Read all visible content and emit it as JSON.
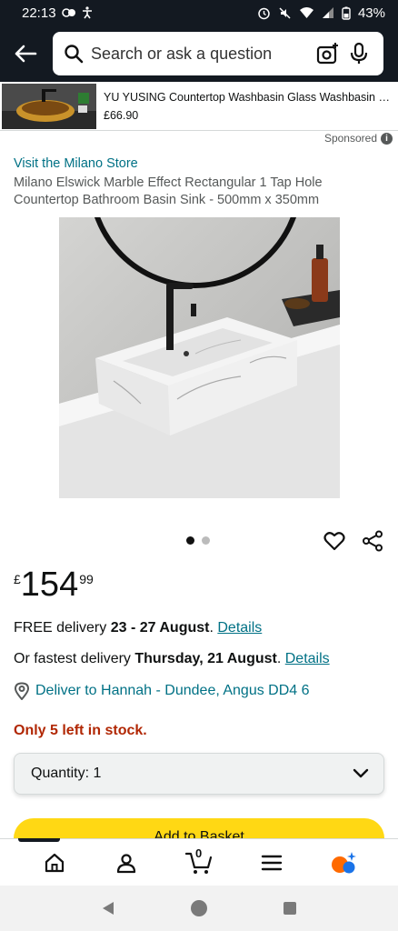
{
  "status_bar": {
    "time": "22:13",
    "battery": "43%"
  },
  "search": {
    "placeholder": "Search or ask a question"
  },
  "sponsored_ad": {
    "title": "YU YUSING Countertop Washbasin Glass Washbasin Oval...",
    "price": "£66.90",
    "sponsored_label": "Sponsored"
  },
  "product": {
    "store_link": "Visit the Milano Store",
    "title": "Milano Elswick Marble Effect Rectangular 1 Tap Hole Countertop Bathroom Basin Sink - 500mm x 350mm",
    "price_symbol": "£",
    "price_whole": "154",
    "price_fraction": "99",
    "image_count": 2,
    "active_image": 1
  },
  "delivery": {
    "free_prefix": "FREE delivery ",
    "free_dates": "23 - 27 August",
    "free_suffix": ". ",
    "free_link": "Details",
    "fast_prefix": "Or fastest delivery ",
    "fast_date": "Thursday, 21 August",
    "fast_suffix": ". ",
    "fast_link": "Details",
    "deliver_to": "Deliver to Hannah - Dundee, Angus DD4 6"
  },
  "stock": "Only 5 left in stock.",
  "quantity": {
    "label": "Quantity: 1"
  },
  "add_to_basket": "Add to Basket",
  "bottom_nav": {
    "cart_count": "0"
  },
  "colors": {
    "header_bg": "#131921",
    "link": "#007185",
    "stock_red": "#b12704",
    "basket_yellow": "#ffd814"
  }
}
